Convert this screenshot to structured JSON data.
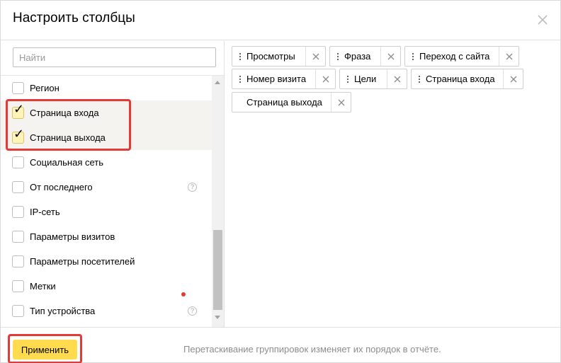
{
  "dialog": {
    "title": "Настроить столбцы",
    "close_icon": "close-icon"
  },
  "search": {
    "placeholder": "Найти",
    "value": ""
  },
  "items": [
    {
      "label": "Регион",
      "checked": false,
      "help": false
    },
    {
      "label": "Страница входа",
      "checked": true,
      "help": false
    },
    {
      "label": "Страница выхода",
      "checked": true,
      "help": false
    },
    {
      "label": "Социальная сеть",
      "checked": false,
      "help": false
    },
    {
      "label": "От последнего",
      "checked": false,
      "help": true
    },
    {
      "label": "IP-сеть",
      "checked": false,
      "help": false
    },
    {
      "label": "Параметры визитов",
      "checked": false,
      "help": false
    },
    {
      "label": "Параметры посетителей",
      "checked": false,
      "help": false
    },
    {
      "label": "Метки",
      "checked": false,
      "help": false
    },
    {
      "label": "Тип устройства",
      "checked": false,
      "help": true,
      "badge": true
    }
  ],
  "help_glyph": "?",
  "check_glyph": "✓",
  "chips": [
    {
      "label": "Просмотры"
    },
    {
      "label": "Фраза"
    },
    {
      "label": "Переход с сайта"
    },
    {
      "label": "Номер визита"
    },
    {
      "label": "Цели"
    },
    {
      "label": "Страница входа"
    },
    {
      "label": "Страница выхода"
    }
  ],
  "footer": {
    "apply_label": "Применить",
    "note": "Перетаскивание группировок изменяет их порядок в отчёте."
  },
  "colors": {
    "accent": "#ffdb4d",
    "highlight": "#e53935",
    "checked_bg": "#f4f3f0"
  }
}
